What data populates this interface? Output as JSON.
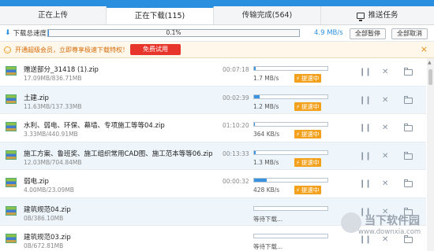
{
  "tabs": [
    {
      "label": "正在上传"
    },
    {
      "label": "正在下载(115)"
    },
    {
      "label": "传输完成(564)"
    },
    {
      "label": "推送任务"
    }
  ],
  "speedbar": {
    "label": "下载总速度",
    "percent_text": "0.1%",
    "progress": 0.1,
    "speed": "4.9 MB/s",
    "pause_all": "全部暂停",
    "cancel_all": "全部取消"
  },
  "banner": {
    "text": "开通超级会员，立即尊享极速下载特权！",
    "trial_button": "免费试用"
  },
  "files": [
    {
      "name": "赠送部分_31418 (1).zip",
      "size": "17.09MB/836.71MB",
      "remain": "00:07:18",
      "speed": "1.7 MB/s",
      "progress": 2,
      "accel": "提速中"
    },
    {
      "name": "土建.zip",
      "size": "11.63MB/137.33MB",
      "remain": "00:02:39",
      "speed": "1.2 MB/s",
      "progress": 8,
      "accel": "提速中"
    },
    {
      "name": "水利、弱电、环保、幕墙、专项施工等等04.zip",
      "size": "3.33MB/440.91MB",
      "remain": "01:10:20",
      "speed": "364 KB/s",
      "progress": 1,
      "accel": "提速中"
    },
    {
      "name": "施工方案、鲁班奖、施工组织常用CAD图、施工范本等等06.zip",
      "size": "12.03MB/704.84MB",
      "remain": "00:13:33",
      "speed": "1.3 MB/s",
      "progress": 2,
      "accel": "提速中"
    },
    {
      "name": "弱电.zip",
      "size": "4.00MB/23.09MB",
      "remain": "00:00:32",
      "speed": "428 KB/s",
      "progress": 17,
      "accel": "提速中"
    },
    {
      "name": "建筑规范04.zip",
      "size": "0B/386.10MB",
      "remain": "",
      "speed": "等待下载...",
      "progress": 0,
      "accel": ""
    },
    {
      "name": "建筑规范03.zip",
      "size": "0B/672.81MB",
      "remain": "",
      "speed": "等待下载...",
      "progress": 0,
      "accel": ""
    }
  ],
  "watermark": {
    "title": "当下软件园",
    "url": "www.downxia.com"
  }
}
